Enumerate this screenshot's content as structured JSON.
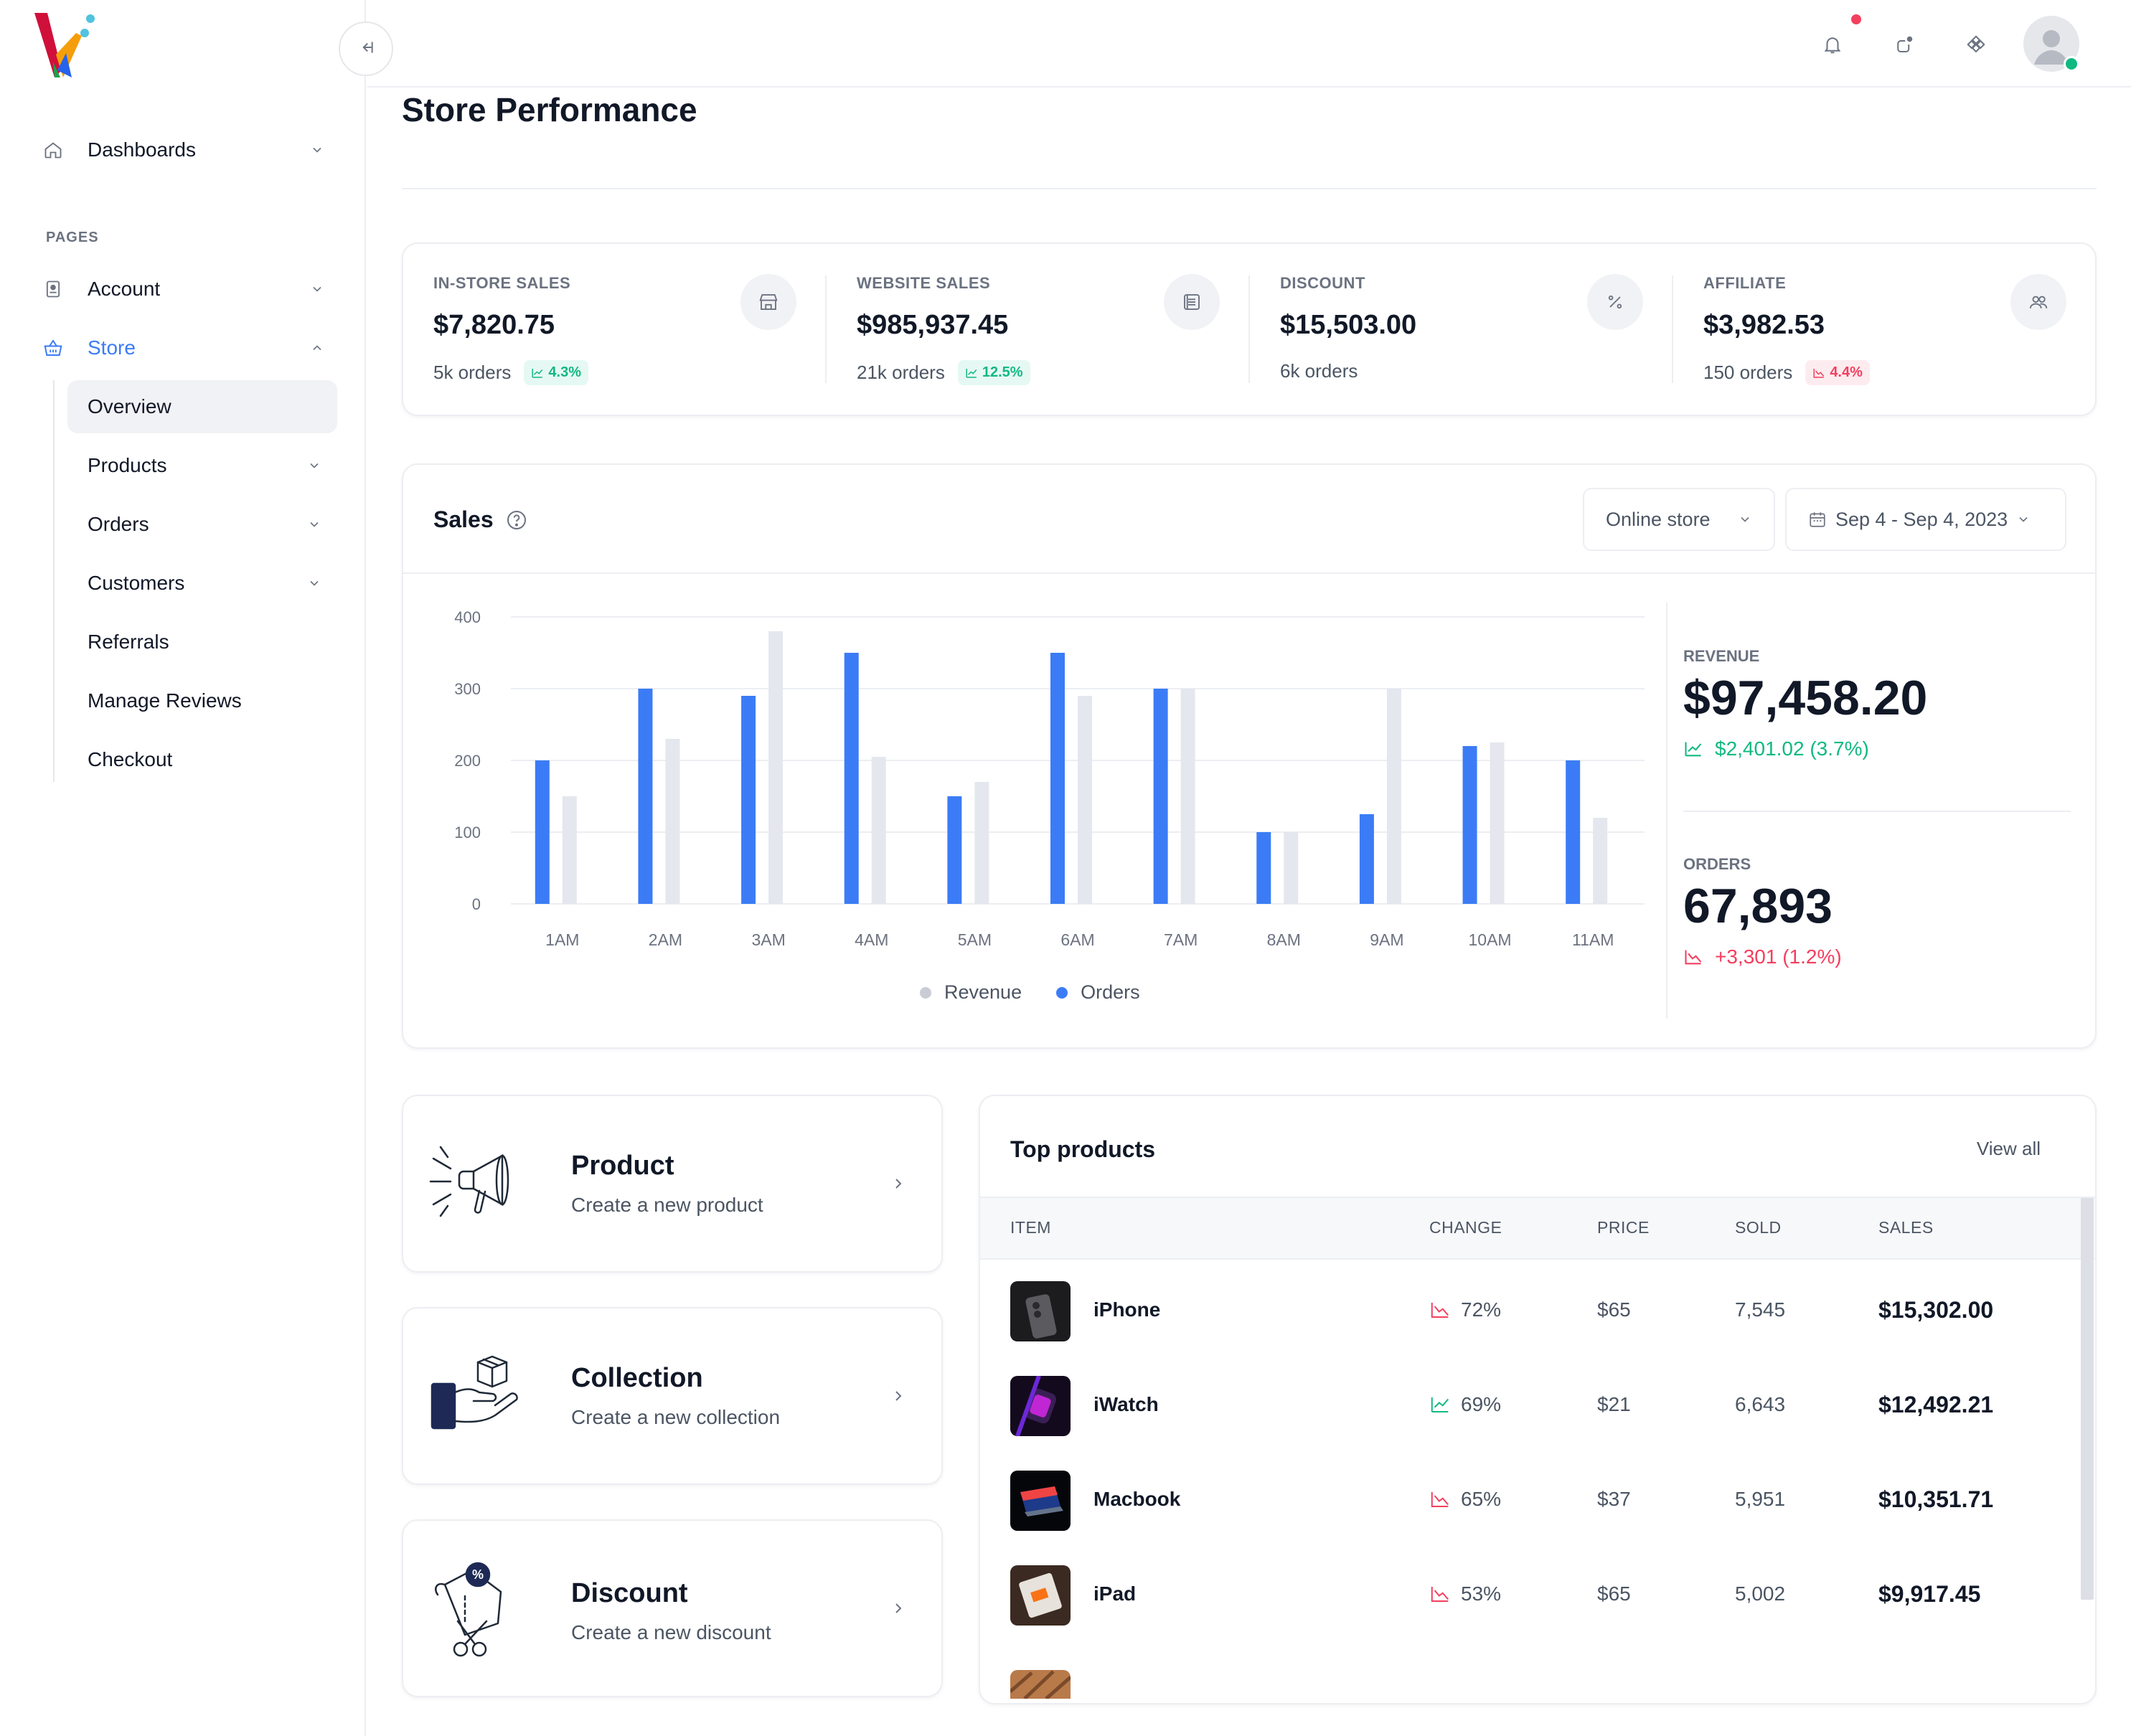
{
  "sidebar": {
    "dashboards_label": "Dashboards",
    "pages_label": "PAGES",
    "account_label": "Account",
    "store_label": "Store",
    "sub_items": [
      {
        "label": "Overview"
      },
      {
        "label": "Products"
      },
      {
        "label": "Orders"
      },
      {
        "label": "Customers"
      },
      {
        "label": "Referrals"
      },
      {
        "label": "Manage Reviews"
      },
      {
        "label": "Checkout"
      }
    ]
  },
  "header": {
    "title": "Store Performance"
  },
  "stats": [
    {
      "label": "IN-STORE SALES",
      "value": "$7,820.75",
      "orders": "5k orders",
      "badge": "4.3%",
      "trend": "up",
      "icon": "store-icon"
    },
    {
      "label": "WEBSITE SALES",
      "value": "$985,937.45",
      "orders": "21k orders",
      "badge": "12.5%",
      "trend": "up",
      "icon": "list-icon"
    },
    {
      "label": "DISCOUNT",
      "value": "$15,503.00",
      "orders": "6k orders",
      "badge": "",
      "trend": "",
      "icon": "percent-icon"
    },
    {
      "label": "AFFILIATE",
      "value": "$3,982.53",
      "orders": "150 orders",
      "badge": "4.4%",
      "trend": "down",
      "icon": "users-icon"
    }
  ],
  "sales": {
    "title": "Sales",
    "store_select": "Online store",
    "date_range": "Sep 4 - Sep 4, 2023",
    "revenue_label": "REVENUE",
    "revenue_value": "$97,458.20",
    "revenue_change": "$2,401.02 (3.7%)",
    "orders_label": "ORDERS",
    "orders_value": "67,893",
    "orders_change": "+3,301 (1.2%)"
  },
  "colors": {
    "orders": "#3b7cf6",
    "revenue": "#e5e7ef",
    "positive": "#10b981",
    "negative": "#f43f5e"
  },
  "chart_data": {
    "type": "bar",
    "categories": [
      "1AM",
      "2AM",
      "3AM",
      "4AM",
      "5AM",
      "6AM",
      "7AM",
      "8AM",
      "9AM",
      "10AM",
      "11AM"
    ],
    "series": [
      {
        "name": "Orders",
        "values": [
          200,
          300,
          290,
          350,
          150,
          350,
          300,
          100,
          125,
          220,
          200
        ]
      },
      {
        "name": "Revenue",
        "values": [
          150,
          230,
          380,
          205,
          170,
          290,
          300,
          100,
          300,
          225,
          120
        ]
      }
    ],
    "yticks": [
      0,
      100,
      200,
      300,
      400
    ],
    "ylim": [
      0,
      400
    ],
    "grid": true,
    "legend": "bottom-center",
    "legend_labels": [
      "Revenue",
      "Orders"
    ]
  },
  "actions": [
    {
      "title": "Product",
      "subtitle": "Create a new product",
      "icon": "megaphone-icon"
    },
    {
      "title": "Collection",
      "subtitle": "Create a new collection",
      "icon": "hand-box-icon"
    },
    {
      "title": "Discount",
      "subtitle": "Create a new discount",
      "icon": "discount-tag-icon"
    }
  ],
  "top_products": {
    "title": "Top products",
    "view_all": "View all",
    "columns": [
      "ITEM",
      "CHANGE",
      "PRICE",
      "SOLD",
      "SALES"
    ],
    "rows": [
      {
        "name": "iPhone",
        "change": "72%",
        "trend": "down",
        "price": "$65",
        "sold": "7,545",
        "sales": "$15,302.00"
      },
      {
        "name": "iWatch",
        "change": "69%",
        "trend": "up",
        "price": "$21",
        "sold": "6,643",
        "sales": "$12,492.21"
      },
      {
        "name": "Macbook",
        "change": "65%",
        "trend": "down",
        "price": "$37",
        "sold": "5,951",
        "sales": "$10,351.71"
      },
      {
        "name": "iPad",
        "change": "53%",
        "trend": "down",
        "price": "$65",
        "sold": "5,002",
        "sales": "$9,917.45"
      }
    ]
  }
}
